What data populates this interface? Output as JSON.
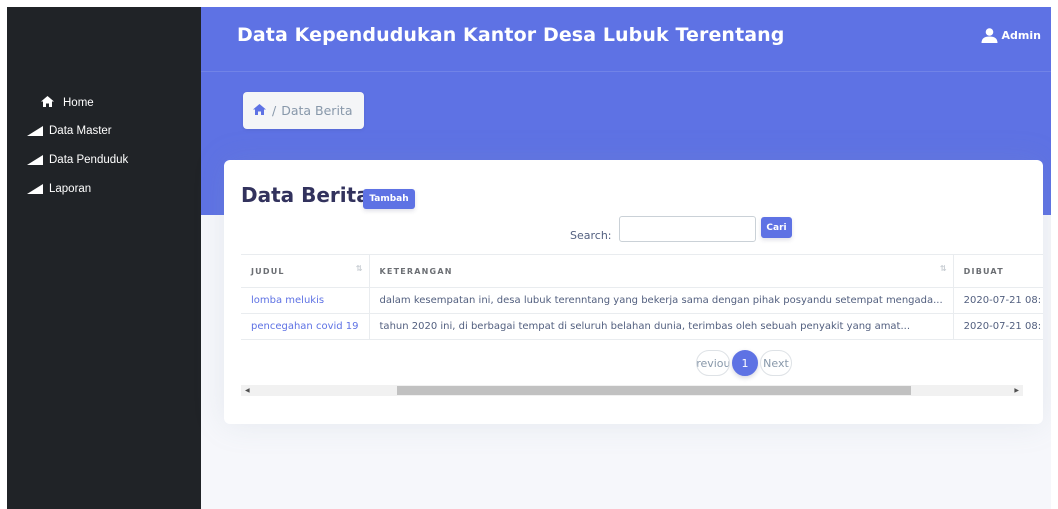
{
  "app": {
    "title": "Data Kependudukan Kantor Desa Lubuk Terentang"
  },
  "user": {
    "name": "Admin",
    "icon": "user-icon"
  },
  "sidebar": {
    "items": [
      {
        "label": "Home",
        "icon": "home-icon"
      },
      {
        "label": "Data Master",
        "icon": "triangle-icon"
      },
      {
        "label": "Data Penduduk",
        "icon": "triangle-icon"
      },
      {
        "label": "Laporan",
        "icon": "triangle-icon"
      }
    ]
  },
  "breadcrumb": {
    "separator": "/",
    "current": "Data Berita",
    "icon": "home-icon"
  },
  "card": {
    "title": "Data Berita",
    "add_button": "Tambah",
    "search_label": "Search:",
    "search_value": "",
    "search_button": "Cari"
  },
  "table": {
    "columns": [
      "JUDUL",
      "KETERANGAN",
      "DIBUAT"
    ],
    "rows": [
      [
        "lomba melukis",
        "dalam kesempatan ini, desa lubuk terenntang yang bekerja sama dengan pihak posyandu setempat mengada...",
        "2020-07-21 08:"
      ],
      [
        "pencegahan covid 19",
        "tahun 2020 ini, di berbagai tempat di seluruh belahan dunia, terimbas oleh sebuah penyakit yang amat...",
        "2020-07-21 08:"
      ]
    ]
  },
  "pagination": {
    "previous": "Previous",
    "current": "1",
    "next": "Next"
  },
  "colors": {
    "primary": "#5e72e4",
    "sidebar": "#202327"
  }
}
